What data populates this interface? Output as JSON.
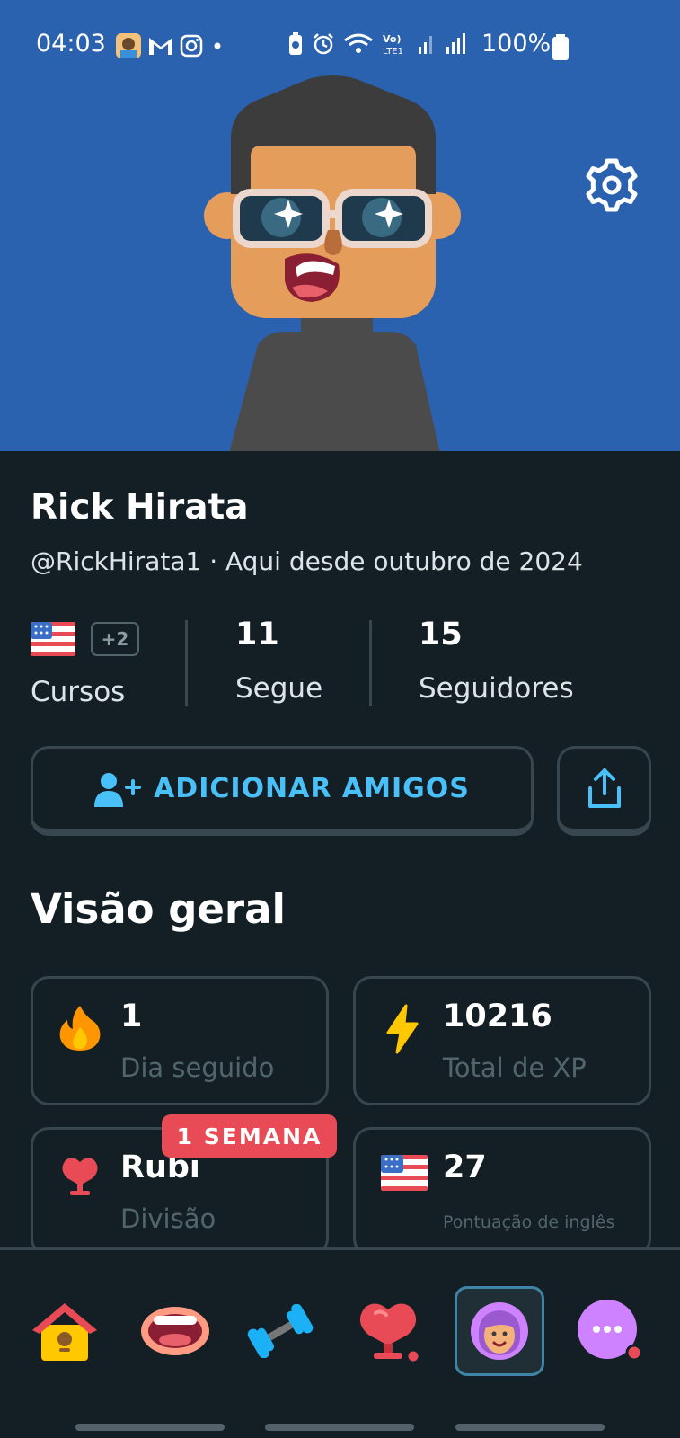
{
  "status_bar": {
    "time": "04:03",
    "battery_percent": "100%"
  },
  "profile": {
    "name": "Rick Hirata",
    "handle_line": "@RickHirata1 · Aqui desde outubro de 2024"
  },
  "stats": {
    "courses_extra": "+2",
    "courses_label": "Cursos",
    "following_count": "11",
    "following_label": "Segue",
    "followers_count": "15",
    "followers_label": "Seguidores"
  },
  "actions": {
    "add_friends_label": "ADICIONAR AMIGOS"
  },
  "overview": {
    "title": "Visão geral",
    "streak_value": "1",
    "streak_label": "Dia seguido",
    "xp_value": "10216",
    "xp_label": "Total de XP",
    "division_badge": "1 SEMANA",
    "division_value": "Rubi",
    "division_label": "Divisão",
    "score_value": "27",
    "score_label": "Pontuação de inglês"
  },
  "colors": {
    "header_bg": "#2b62b0",
    "page_bg": "#131f24",
    "accent_blue": "#49c0f8",
    "badge_red": "#e84b55",
    "border": "#37464f"
  },
  "icons": [
    "settings-gear-icon",
    "add-user-icon",
    "share-icon",
    "fire-icon",
    "lightning-icon",
    "ruby-trophy-icon",
    "us-flag-icon",
    "home-icon",
    "mouth-icon",
    "dumbbell-icon",
    "leagues-icon",
    "profile-avatar-icon",
    "more-icon"
  ]
}
